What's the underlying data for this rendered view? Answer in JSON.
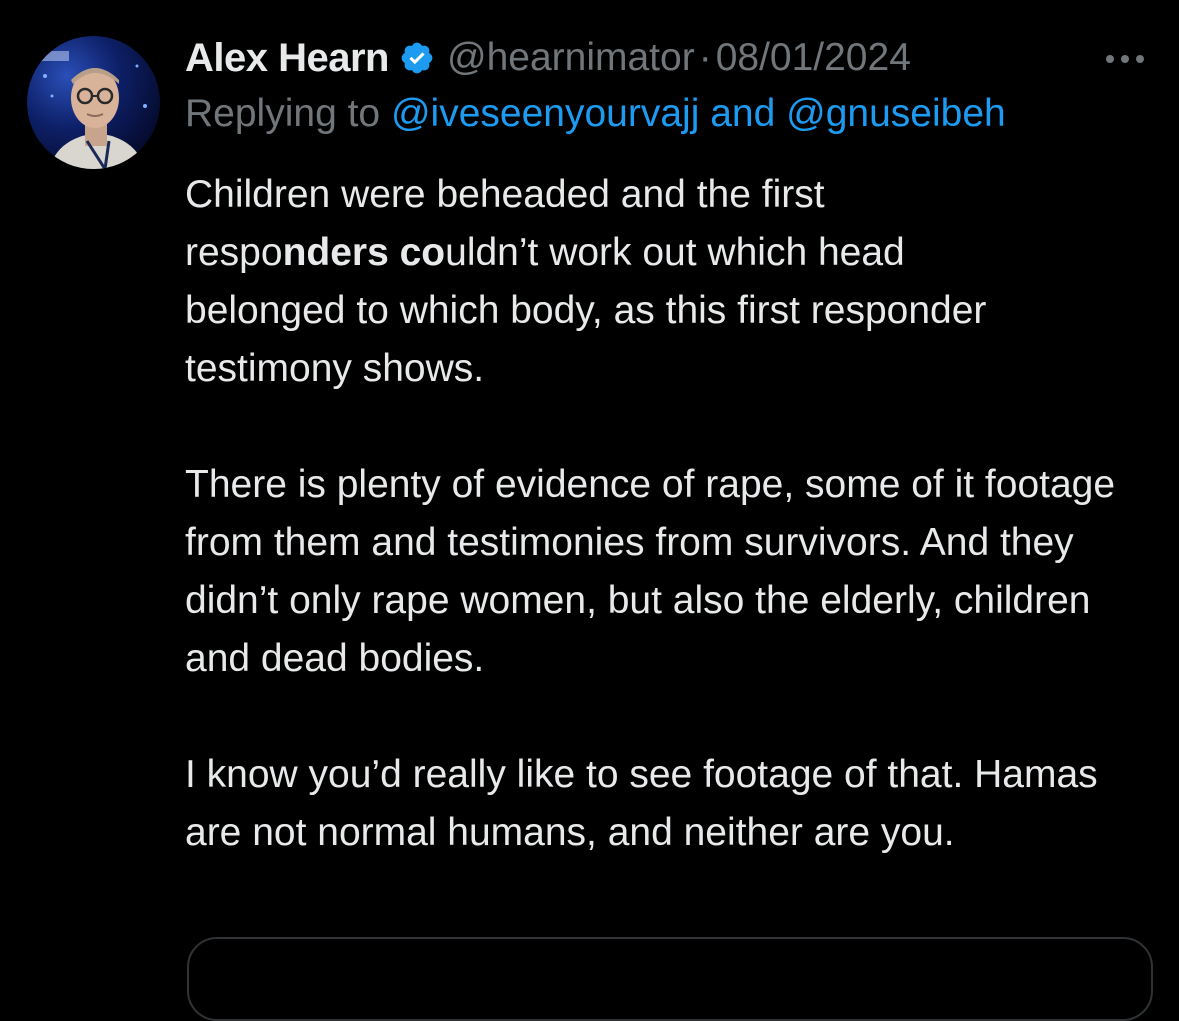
{
  "tweet": {
    "author": {
      "display_name": "Alex Hearn",
      "handle": "@hearnimator",
      "verified": true,
      "avatar_icon": "profile-photo"
    },
    "separator": "·",
    "date": "08/01/2024",
    "more_icon": "more-horizontal-icon",
    "reply": {
      "prefix": "Replying to",
      "mentions": [
        "@iveseenyourvajj",
        "@gnuseibeh"
      ],
      "joiner": "and"
    },
    "body": {
      "p1": {
        "line1": "Children were beheaded and the first",
        "line2_pre": "respo",
        "line2_bold1": "nders co",
        "line2_post": "uldn’t work out which head",
        "line3": "belonged to which body, as this first responder",
        "line4": "testimony shows."
      },
      "p2": "There is plenty of evidence of rape, some of it footage from them and testimonies from survivors. And they didn’t only rape women, but also the elderly, children and dead bodies.",
      "p3": "I know you’d really like to see footage of that. Hamas are not normal humans, and neither are you."
    }
  },
  "colors": {
    "background": "#000000",
    "text_primary": "#e7e9ea",
    "text_secondary": "#71767b",
    "link": "#1d9bf0",
    "verified_badge": "#1d9bf0",
    "border": "#2f3336"
  }
}
